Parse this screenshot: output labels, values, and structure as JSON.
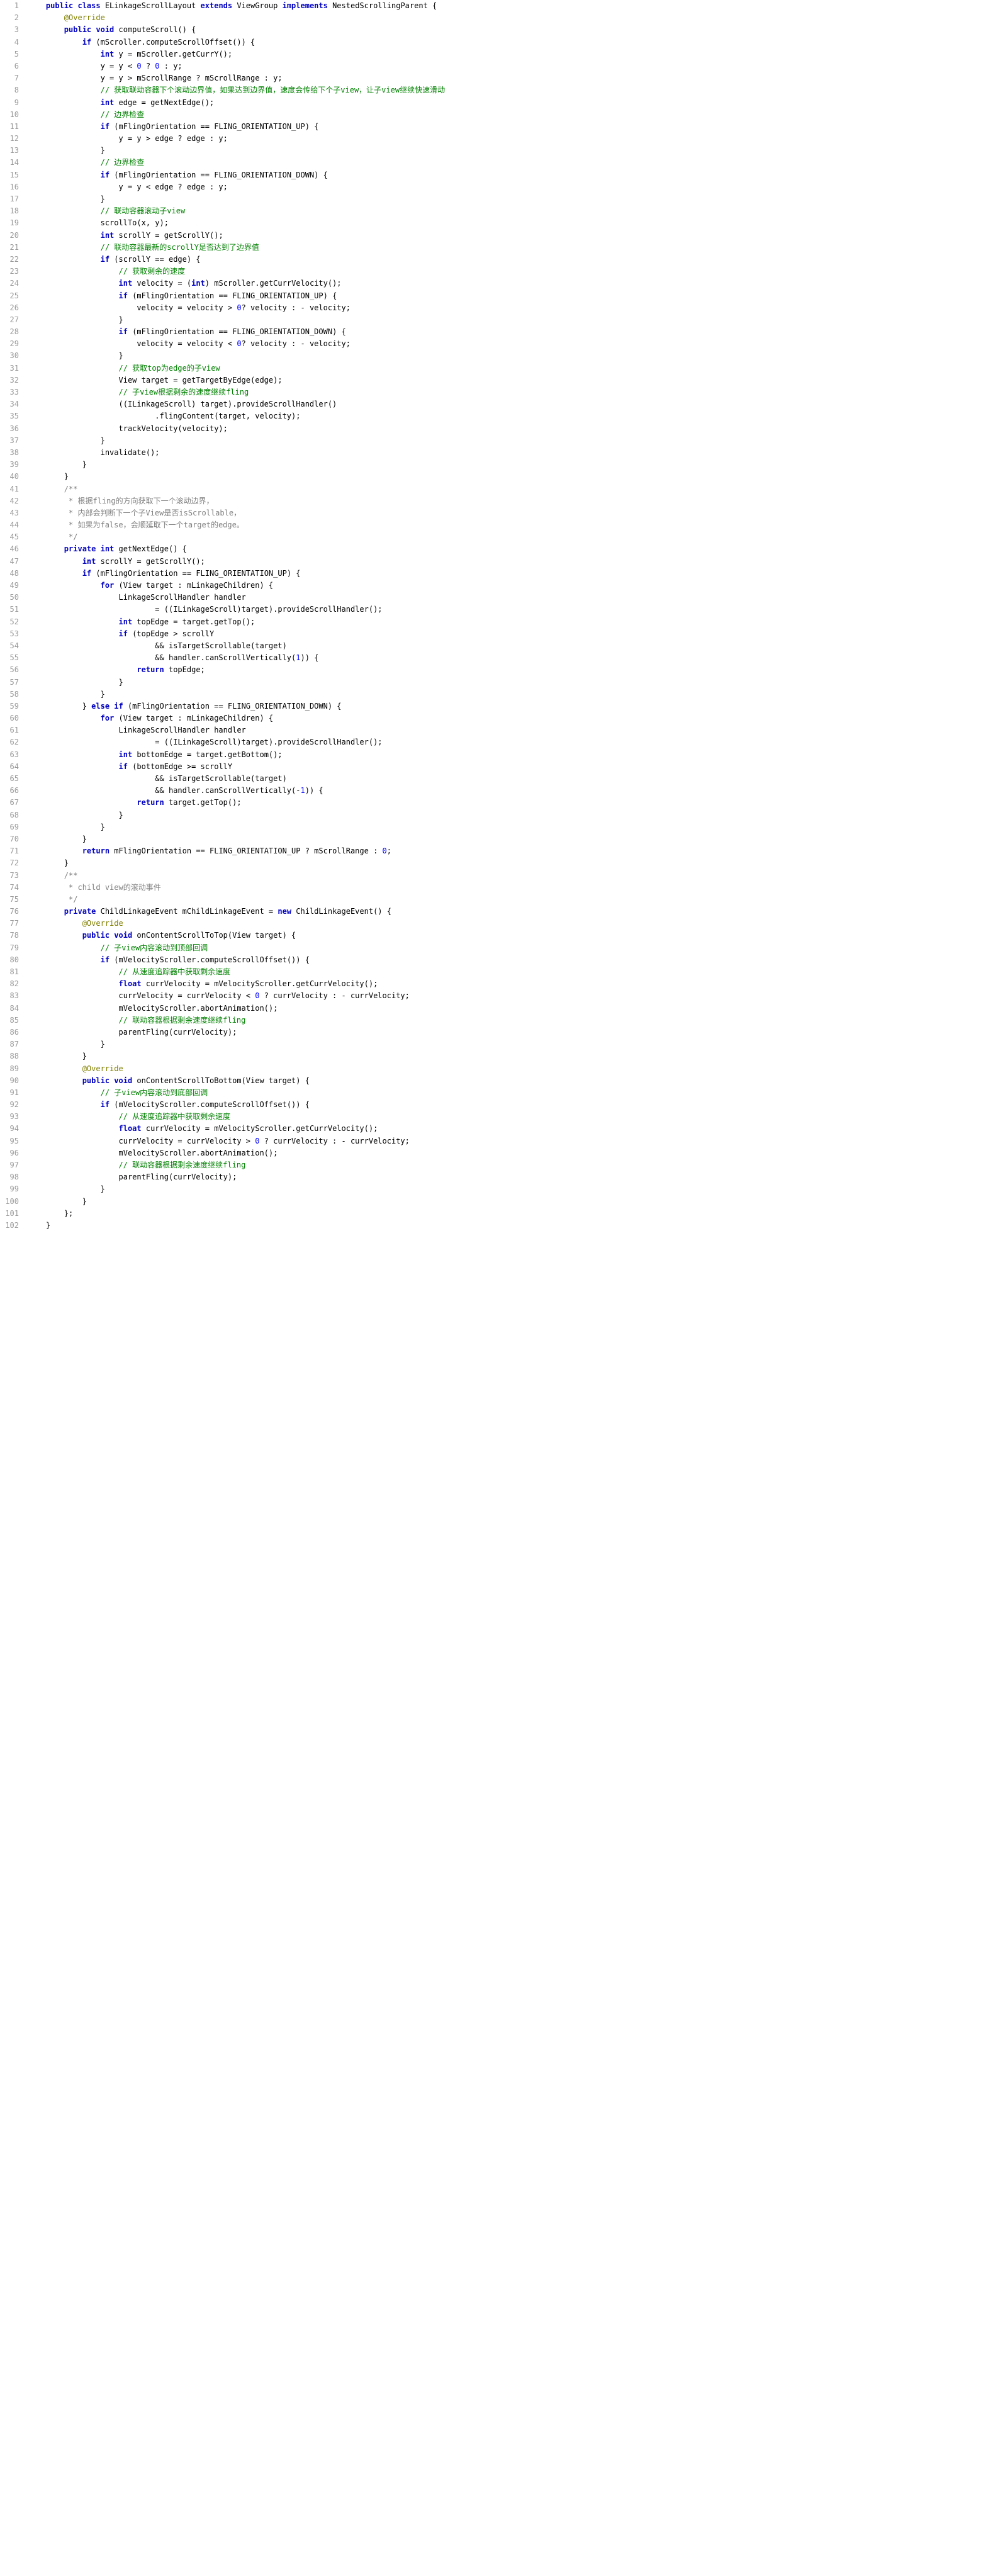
{
  "lines": [
    {
      "n": 1,
      "segs": [
        {
          "t": "    "
        },
        {
          "t": "public class ",
          "c": "kw"
        },
        {
          "t": "ELinkageScrollLayout "
        },
        {
          "t": "extends ",
          "c": "kw"
        },
        {
          "t": "ViewGroup "
        },
        {
          "t": "implements ",
          "c": "kw"
        },
        {
          "t": "NestedScrollingParent {"
        }
      ]
    },
    {
      "n": 2,
      "segs": [
        {
          "t": "        "
        },
        {
          "t": "@Override",
          "c": "ann"
        }
      ]
    },
    {
      "n": 3,
      "segs": [
        {
          "t": "        "
        },
        {
          "t": "public void ",
          "c": "kw"
        },
        {
          "t": "computeScroll() {"
        }
      ]
    },
    {
      "n": 4,
      "segs": [
        {
          "t": "            "
        },
        {
          "t": "if ",
          "c": "kw"
        },
        {
          "t": "(mScroller.computeScrollOffset()) {"
        }
      ]
    },
    {
      "n": 5,
      "segs": [
        {
          "t": "                "
        },
        {
          "t": "int ",
          "c": "kw"
        },
        {
          "t": "y = mScroller.getCurrY();"
        }
      ]
    },
    {
      "n": 6,
      "segs": [
        {
          "t": "                y = y < "
        },
        {
          "t": "0 ",
          "c": "num"
        },
        {
          "t": "? "
        },
        {
          "t": "0 ",
          "c": "num"
        },
        {
          "t": ": y;"
        }
      ]
    },
    {
      "n": 7,
      "segs": [
        {
          "t": "                y = y > mScrollRange ? mScrollRange : y;"
        }
      ]
    },
    {
      "n": 8,
      "segs": [
        {
          "t": "                "
        },
        {
          "t": "// 获取联动容器下个滚动边界值，如果达到边界值，速度会传给下个子view，让子view继续快速滑动",
          "c": "cm"
        }
      ]
    },
    {
      "n": 9,
      "segs": [
        {
          "t": "                "
        },
        {
          "t": "int ",
          "c": "kw"
        },
        {
          "t": "edge = getNextEdge();"
        }
      ]
    },
    {
      "n": 10,
      "segs": [
        {
          "t": "                "
        },
        {
          "t": "// 边界检查",
          "c": "cm"
        }
      ]
    },
    {
      "n": 11,
      "segs": [
        {
          "t": "                "
        },
        {
          "t": "if ",
          "c": "kw"
        },
        {
          "t": "(mFlingOrientation == FLING_ORIENTATION_UP) {"
        }
      ]
    },
    {
      "n": 12,
      "segs": [
        {
          "t": "                    y = y > edge ? edge : y;"
        }
      ]
    },
    {
      "n": 13,
      "segs": [
        {
          "t": "                }"
        }
      ]
    },
    {
      "n": 14,
      "segs": [
        {
          "t": "                "
        },
        {
          "t": "// 边界检查",
          "c": "cm"
        }
      ]
    },
    {
      "n": 15,
      "segs": [
        {
          "t": "                "
        },
        {
          "t": "if ",
          "c": "kw"
        },
        {
          "t": "(mFlingOrientation == FLING_ORIENTATION_DOWN) {"
        }
      ]
    },
    {
      "n": 16,
      "segs": [
        {
          "t": "                    y = y < edge ? edge : y;"
        }
      ]
    },
    {
      "n": 17,
      "segs": [
        {
          "t": "                }"
        }
      ]
    },
    {
      "n": 18,
      "segs": [
        {
          "t": "                "
        },
        {
          "t": "// 联动容器滚动子view",
          "c": "cm"
        }
      ]
    },
    {
      "n": 19,
      "segs": [
        {
          "t": "                scrollTo(x, y);"
        }
      ]
    },
    {
      "n": 20,
      "segs": [
        {
          "t": "                "
        },
        {
          "t": "int ",
          "c": "kw"
        },
        {
          "t": "scrollY = getScrollY();"
        }
      ]
    },
    {
      "n": 21,
      "segs": [
        {
          "t": "                "
        },
        {
          "t": "// 联动容器最新的scrollY是否达到了边界值",
          "c": "cm"
        }
      ]
    },
    {
      "n": 22,
      "segs": [
        {
          "t": "                "
        },
        {
          "t": "if ",
          "c": "kw"
        },
        {
          "t": "(scrollY == edge) {"
        }
      ]
    },
    {
      "n": 23,
      "segs": [
        {
          "t": "                    "
        },
        {
          "t": "// 获取剩余的速度",
          "c": "cm"
        }
      ]
    },
    {
      "n": 24,
      "segs": [
        {
          "t": "                    "
        },
        {
          "t": "int ",
          "c": "kw"
        },
        {
          "t": "velocity = ("
        },
        {
          "t": "int",
          "c": "kw"
        },
        {
          "t": ") mScroller.getCurrVelocity();"
        }
      ]
    },
    {
      "n": 25,
      "segs": [
        {
          "t": "                    "
        },
        {
          "t": "if ",
          "c": "kw"
        },
        {
          "t": "(mFlingOrientation == FLING_ORIENTATION_UP) {"
        }
      ]
    },
    {
      "n": 26,
      "segs": [
        {
          "t": "                        velocity = velocity > "
        },
        {
          "t": "0",
          "c": "num"
        },
        {
          "t": "? velocity : - velocity;"
        }
      ]
    },
    {
      "n": 27,
      "segs": [
        {
          "t": "                    }"
        }
      ]
    },
    {
      "n": 28,
      "segs": [
        {
          "t": "                    "
        },
        {
          "t": "if ",
          "c": "kw"
        },
        {
          "t": "(mFlingOrientation == FLING_ORIENTATION_DOWN) {"
        }
      ]
    },
    {
      "n": 29,
      "segs": [
        {
          "t": "                        velocity = velocity < "
        },
        {
          "t": "0",
          "c": "num"
        },
        {
          "t": "? velocity : - velocity;"
        }
      ]
    },
    {
      "n": 30,
      "segs": [
        {
          "t": "                    }"
        }
      ]
    },
    {
      "n": 31,
      "segs": [
        {
          "t": "                    "
        },
        {
          "t": "// 获取top为edge的子view",
          "c": "cm"
        }
      ]
    },
    {
      "n": 32,
      "segs": [
        {
          "t": "                    View target = getTargetByEdge(edge);"
        }
      ]
    },
    {
      "n": 33,
      "segs": [
        {
          "t": "                    "
        },
        {
          "t": "// 子view根据剩余的速度继续fling",
          "c": "cm"
        }
      ]
    },
    {
      "n": 34,
      "segs": [
        {
          "t": "                    ((ILinkageScroll) target).provideScrollHandler()"
        }
      ]
    },
    {
      "n": 35,
      "segs": [
        {
          "t": "                            .flingContent(target, velocity);"
        }
      ]
    },
    {
      "n": 36,
      "segs": [
        {
          "t": "                    trackVelocity(velocity);"
        }
      ]
    },
    {
      "n": 37,
      "segs": [
        {
          "t": "                }"
        }
      ]
    },
    {
      "n": 38,
      "segs": [
        {
          "t": "                invalidate();"
        }
      ]
    },
    {
      "n": 39,
      "segs": [
        {
          "t": "            }"
        }
      ]
    },
    {
      "n": 40,
      "segs": [
        {
          "t": "        }"
        }
      ]
    },
    {
      "n": 41,
      "segs": [
        {
          "t": "        "
        },
        {
          "t": "/**",
          "c": "jd"
        }
      ]
    },
    {
      "n": 42,
      "segs": [
        {
          "t": "         "
        },
        {
          "t": "* 根据fling的方向获取下一个滚动边界，",
          "c": "jd"
        }
      ]
    },
    {
      "n": 43,
      "segs": [
        {
          "t": "         "
        },
        {
          "t": "* 内部会判断下一个子View是否isScrollable，",
          "c": "jd"
        }
      ]
    },
    {
      "n": 44,
      "segs": [
        {
          "t": "         "
        },
        {
          "t": "* 如果为false，会顺延取下一个target的edge。",
          "c": "jd"
        }
      ]
    },
    {
      "n": 45,
      "segs": [
        {
          "t": "         "
        },
        {
          "t": "*/",
          "c": "jd"
        }
      ]
    },
    {
      "n": 46,
      "segs": [
        {
          "t": "        "
        },
        {
          "t": "private int ",
          "c": "kw"
        },
        {
          "t": "getNextEdge() {"
        }
      ]
    },
    {
      "n": 47,
      "segs": [
        {
          "t": "            "
        },
        {
          "t": "int ",
          "c": "kw"
        },
        {
          "t": "scrollY = getScrollY();"
        }
      ]
    },
    {
      "n": 48,
      "segs": [
        {
          "t": "            "
        },
        {
          "t": "if ",
          "c": "kw"
        },
        {
          "t": "(mFlingOrientation == FLING_ORIENTATION_UP) {"
        }
      ]
    },
    {
      "n": 49,
      "segs": [
        {
          "t": "                "
        },
        {
          "t": "for ",
          "c": "kw"
        },
        {
          "t": "(View target : mLinkageChildren) {"
        }
      ]
    },
    {
      "n": 50,
      "segs": [
        {
          "t": "                    LinkageScrollHandler handler"
        }
      ]
    },
    {
      "n": 51,
      "segs": [
        {
          "t": "                            = ((ILinkageScroll)target).provideScrollHandler();"
        }
      ]
    },
    {
      "n": 52,
      "segs": [
        {
          "t": "                    "
        },
        {
          "t": "int ",
          "c": "kw"
        },
        {
          "t": "topEdge = target.getTop();"
        }
      ]
    },
    {
      "n": 53,
      "segs": [
        {
          "t": "                    "
        },
        {
          "t": "if ",
          "c": "kw"
        },
        {
          "t": "(topEdge > scrollY"
        }
      ]
    },
    {
      "n": 54,
      "segs": [
        {
          "t": "                            && isTargetScrollable(target)"
        }
      ]
    },
    {
      "n": 55,
      "segs": [
        {
          "t": "                            && handler.canScrollVertically("
        },
        {
          "t": "1",
          "c": "num"
        },
        {
          "t": ")) {"
        }
      ]
    },
    {
      "n": 56,
      "segs": [
        {
          "t": "                        "
        },
        {
          "t": "return ",
          "c": "kw"
        },
        {
          "t": "topEdge;"
        }
      ]
    },
    {
      "n": 57,
      "segs": [
        {
          "t": "                    }"
        }
      ]
    },
    {
      "n": 58,
      "segs": [
        {
          "t": "                }"
        }
      ]
    },
    {
      "n": 59,
      "segs": [
        {
          "t": "            } "
        },
        {
          "t": "else if ",
          "c": "kw"
        },
        {
          "t": "(mFlingOrientation == FLING_ORIENTATION_DOWN) {"
        }
      ]
    },
    {
      "n": 60,
      "segs": [
        {
          "t": "                "
        },
        {
          "t": "for ",
          "c": "kw"
        },
        {
          "t": "(View target : mLinkageChildren) {"
        }
      ]
    },
    {
      "n": 61,
      "segs": [
        {
          "t": "                    LinkageScrollHandler handler"
        }
      ]
    },
    {
      "n": 62,
      "segs": [
        {
          "t": "                            = ((ILinkageScroll)target).provideScrollHandler();"
        }
      ]
    },
    {
      "n": 63,
      "segs": [
        {
          "t": "                    "
        },
        {
          "t": "int ",
          "c": "kw"
        },
        {
          "t": "bottomEdge = target.getBottom();"
        }
      ]
    },
    {
      "n": 64,
      "segs": [
        {
          "t": "                    "
        },
        {
          "t": "if ",
          "c": "kw"
        },
        {
          "t": "(bottomEdge >= scrollY"
        }
      ]
    },
    {
      "n": 65,
      "segs": [
        {
          "t": "                            && isTargetScrollable(target)"
        }
      ]
    },
    {
      "n": 66,
      "segs": [
        {
          "t": "                            && handler.canScrollVertically(-"
        },
        {
          "t": "1",
          "c": "num"
        },
        {
          "t": ")) {"
        }
      ]
    },
    {
      "n": 67,
      "segs": [
        {
          "t": "                        "
        },
        {
          "t": "return ",
          "c": "kw"
        },
        {
          "t": "target.getTop();"
        }
      ]
    },
    {
      "n": 68,
      "segs": [
        {
          "t": "                    }"
        }
      ]
    },
    {
      "n": 69,
      "segs": [
        {
          "t": "                }"
        }
      ]
    },
    {
      "n": 70,
      "segs": [
        {
          "t": "            }"
        }
      ]
    },
    {
      "n": 71,
      "segs": [
        {
          "t": "            "
        },
        {
          "t": "return ",
          "c": "kw"
        },
        {
          "t": "mFlingOrientation == FLING_ORIENTATION_UP ? mScrollRange : "
        },
        {
          "t": "0",
          "c": "num"
        },
        {
          "t": ";"
        }
      ]
    },
    {
      "n": 72,
      "segs": [
        {
          "t": "        }"
        }
      ]
    },
    {
      "n": 73,
      "segs": [
        {
          "t": "        "
        },
        {
          "t": "/**",
          "c": "jd"
        }
      ]
    },
    {
      "n": 74,
      "segs": [
        {
          "t": "         "
        },
        {
          "t": "* child view的滚动事件",
          "c": "jd"
        }
      ]
    },
    {
      "n": 75,
      "segs": [
        {
          "t": "         "
        },
        {
          "t": "*/",
          "c": "jd"
        }
      ]
    },
    {
      "n": 76,
      "segs": [
        {
          "t": "        "
        },
        {
          "t": "private ",
          "c": "kw"
        },
        {
          "t": "ChildLinkageEvent mChildLinkageEvent = "
        },
        {
          "t": "new ",
          "c": "kw"
        },
        {
          "t": "ChildLinkageEvent() {"
        }
      ]
    },
    {
      "n": 77,
      "segs": [
        {
          "t": "            "
        },
        {
          "t": "@Override",
          "c": "ann"
        }
      ]
    },
    {
      "n": 78,
      "segs": [
        {
          "t": "            "
        },
        {
          "t": "public void ",
          "c": "kw"
        },
        {
          "t": "onContentScrollToTop(View target) {"
        }
      ]
    },
    {
      "n": 79,
      "segs": [
        {
          "t": "                "
        },
        {
          "t": "// 子view内容滚动到顶部回调",
          "c": "cm"
        }
      ]
    },
    {
      "n": 80,
      "segs": [
        {
          "t": "                "
        },
        {
          "t": "if ",
          "c": "kw"
        },
        {
          "t": "(mVelocityScroller.computeScrollOffset()) {"
        }
      ]
    },
    {
      "n": 81,
      "segs": [
        {
          "t": "                    "
        },
        {
          "t": "// 从速度追踪器中获取剩余速度",
          "c": "cm"
        }
      ]
    },
    {
      "n": 82,
      "segs": [
        {
          "t": "                    "
        },
        {
          "t": "float ",
          "c": "kw"
        },
        {
          "t": "currVelocity = mVelocityScroller.getCurrVelocity();"
        }
      ]
    },
    {
      "n": 83,
      "segs": [
        {
          "t": "                    currVelocity = currVelocity < "
        },
        {
          "t": "0 ",
          "c": "num"
        },
        {
          "t": "? currVelocity : - currVelocity;"
        }
      ]
    },
    {
      "n": 84,
      "segs": [
        {
          "t": "                    mVelocityScroller.abortAnimation();"
        }
      ]
    },
    {
      "n": 85,
      "segs": [
        {
          "t": "                    "
        },
        {
          "t": "// 联动容器根据剩余速度继续fling",
          "c": "cm"
        }
      ]
    },
    {
      "n": 86,
      "segs": [
        {
          "t": "                    parentFling(currVelocity);"
        }
      ]
    },
    {
      "n": 87,
      "segs": [
        {
          "t": "                }"
        }
      ]
    },
    {
      "n": 88,
      "segs": [
        {
          "t": "            }"
        }
      ]
    },
    {
      "n": 89,
      "segs": [
        {
          "t": "            "
        },
        {
          "t": "@Override",
          "c": "ann"
        }
      ]
    },
    {
      "n": 90,
      "segs": [
        {
          "t": "            "
        },
        {
          "t": "public void ",
          "c": "kw"
        },
        {
          "t": "onContentScrollToBottom(View target) {"
        }
      ]
    },
    {
      "n": 91,
      "segs": [
        {
          "t": "                "
        },
        {
          "t": "// 子view内容滚动到底部回调",
          "c": "cm"
        }
      ]
    },
    {
      "n": 92,
      "segs": [
        {
          "t": "                "
        },
        {
          "t": "if ",
          "c": "kw"
        },
        {
          "t": "(mVelocityScroller.computeScrollOffset()) {"
        }
      ]
    },
    {
      "n": 93,
      "segs": [
        {
          "t": "                    "
        },
        {
          "t": "// 从速度追踪器中获取剩余速度",
          "c": "cm"
        }
      ]
    },
    {
      "n": 94,
      "segs": [
        {
          "t": "                    "
        },
        {
          "t": "float ",
          "c": "kw"
        },
        {
          "t": "currVelocity = mVelocityScroller.getCurrVelocity();"
        }
      ]
    },
    {
      "n": 95,
      "segs": [
        {
          "t": "                    currVelocity = currVelocity > "
        },
        {
          "t": "0 ",
          "c": "num"
        },
        {
          "t": "? currVelocity : - currVelocity;"
        }
      ]
    },
    {
      "n": 96,
      "segs": [
        {
          "t": "                    mVelocityScroller.abortAnimation();"
        }
      ]
    },
    {
      "n": 97,
      "segs": [
        {
          "t": "                    "
        },
        {
          "t": "// 联动容器根据剩余速度继续fling",
          "c": "cm"
        }
      ]
    },
    {
      "n": 98,
      "segs": [
        {
          "t": "                    parentFling(currVelocity);"
        }
      ]
    },
    {
      "n": 99,
      "segs": [
        {
          "t": "                }"
        }
      ]
    },
    {
      "n": 100,
      "segs": [
        {
          "t": "            }"
        }
      ]
    },
    {
      "n": 101,
      "segs": [
        {
          "t": "        };"
        }
      ]
    },
    {
      "n": 102,
      "segs": [
        {
          "t": "    }"
        }
      ]
    }
  ]
}
